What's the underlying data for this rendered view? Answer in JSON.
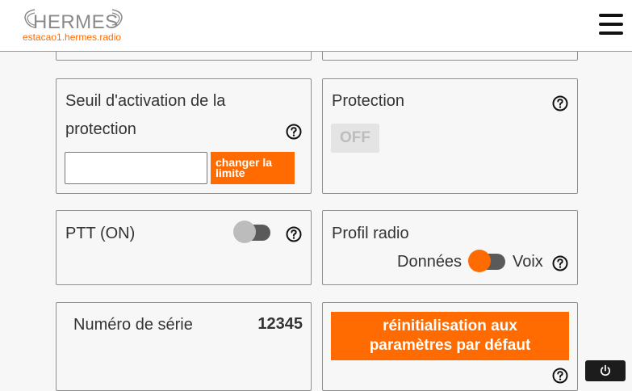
{
  "header": {
    "logo_text": "HERMES",
    "station": "estacao1.hermes.radio"
  },
  "threshold": {
    "label_line1": "Seuil d'activation de la",
    "label_line2": "protection",
    "input_value": "",
    "button_line1": "changer la",
    "button_line2": "limite"
  },
  "protection": {
    "label": "Protection",
    "state": "OFF"
  },
  "ptt": {
    "label": "PTT (ON)",
    "toggle_on": false
  },
  "radio_profile": {
    "label": "Profil radio",
    "left_option": "Données",
    "right_option": "Voix"
  },
  "serial": {
    "label": "Numéro de série",
    "value": "12345"
  },
  "reset": {
    "line1": "réinitialisation aux",
    "line2": "paramètres par défaut"
  },
  "colors": {
    "accent": "#ff6b00",
    "toggle_off_knob": "#bcbcbc",
    "toggle_track": "#5a5a5a"
  },
  "icons": {
    "help": "question-circle-icon",
    "menu": "hamburger-menu-icon",
    "power": "power-icon"
  }
}
